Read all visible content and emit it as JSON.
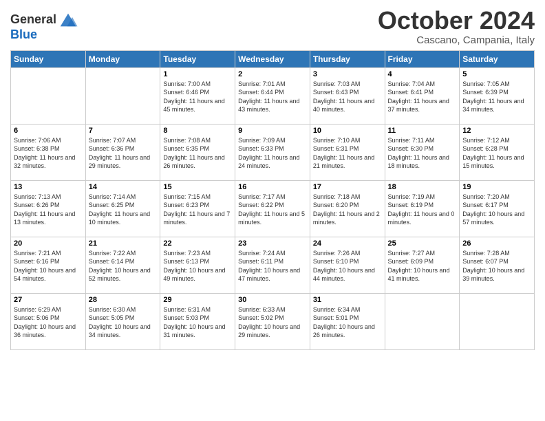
{
  "logo": {
    "line1": "General",
    "line2": "Blue"
  },
  "title": "October 2024",
  "subtitle": "Cascano, Campania, Italy",
  "headers": [
    "Sunday",
    "Monday",
    "Tuesday",
    "Wednesday",
    "Thursday",
    "Friday",
    "Saturday"
  ],
  "weeks": [
    [
      {
        "day": "",
        "info": ""
      },
      {
        "day": "",
        "info": ""
      },
      {
        "day": "1",
        "info": "Sunrise: 7:00 AM\nSunset: 6:46 PM\nDaylight: 11 hours and 45 minutes."
      },
      {
        "day": "2",
        "info": "Sunrise: 7:01 AM\nSunset: 6:44 PM\nDaylight: 11 hours and 43 minutes."
      },
      {
        "day": "3",
        "info": "Sunrise: 7:03 AM\nSunset: 6:43 PM\nDaylight: 11 hours and 40 minutes."
      },
      {
        "day": "4",
        "info": "Sunrise: 7:04 AM\nSunset: 6:41 PM\nDaylight: 11 hours and 37 minutes."
      },
      {
        "day": "5",
        "info": "Sunrise: 7:05 AM\nSunset: 6:39 PM\nDaylight: 11 hours and 34 minutes."
      }
    ],
    [
      {
        "day": "6",
        "info": "Sunrise: 7:06 AM\nSunset: 6:38 PM\nDaylight: 11 hours and 32 minutes."
      },
      {
        "day": "7",
        "info": "Sunrise: 7:07 AM\nSunset: 6:36 PM\nDaylight: 11 hours and 29 minutes."
      },
      {
        "day": "8",
        "info": "Sunrise: 7:08 AM\nSunset: 6:35 PM\nDaylight: 11 hours and 26 minutes."
      },
      {
        "day": "9",
        "info": "Sunrise: 7:09 AM\nSunset: 6:33 PM\nDaylight: 11 hours and 24 minutes."
      },
      {
        "day": "10",
        "info": "Sunrise: 7:10 AM\nSunset: 6:31 PM\nDaylight: 11 hours and 21 minutes."
      },
      {
        "day": "11",
        "info": "Sunrise: 7:11 AM\nSunset: 6:30 PM\nDaylight: 11 hours and 18 minutes."
      },
      {
        "day": "12",
        "info": "Sunrise: 7:12 AM\nSunset: 6:28 PM\nDaylight: 11 hours and 15 minutes."
      }
    ],
    [
      {
        "day": "13",
        "info": "Sunrise: 7:13 AM\nSunset: 6:26 PM\nDaylight: 11 hours and 13 minutes."
      },
      {
        "day": "14",
        "info": "Sunrise: 7:14 AM\nSunset: 6:25 PM\nDaylight: 11 hours and 10 minutes."
      },
      {
        "day": "15",
        "info": "Sunrise: 7:15 AM\nSunset: 6:23 PM\nDaylight: 11 hours and 7 minutes."
      },
      {
        "day": "16",
        "info": "Sunrise: 7:17 AM\nSunset: 6:22 PM\nDaylight: 11 hours and 5 minutes."
      },
      {
        "day": "17",
        "info": "Sunrise: 7:18 AM\nSunset: 6:20 PM\nDaylight: 11 hours and 2 minutes."
      },
      {
        "day": "18",
        "info": "Sunrise: 7:19 AM\nSunset: 6:19 PM\nDaylight: 11 hours and 0 minutes."
      },
      {
        "day": "19",
        "info": "Sunrise: 7:20 AM\nSunset: 6:17 PM\nDaylight: 10 hours and 57 minutes."
      }
    ],
    [
      {
        "day": "20",
        "info": "Sunrise: 7:21 AM\nSunset: 6:16 PM\nDaylight: 10 hours and 54 minutes."
      },
      {
        "day": "21",
        "info": "Sunrise: 7:22 AM\nSunset: 6:14 PM\nDaylight: 10 hours and 52 minutes."
      },
      {
        "day": "22",
        "info": "Sunrise: 7:23 AM\nSunset: 6:13 PM\nDaylight: 10 hours and 49 minutes."
      },
      {
        "day": "23",
        "info": "Sunrise: 7:24 AM\nSunset: 6:11 PM\nDaylight: 10 hours and 47 minutes."
      },
      {
        "day": "24",
        "info": "Sunrise: 7:26 AM\nSunset: 6:10 PM\nDaylight: 10 hours and 44 minutes."
      },
      {
        "day": "25",
        "info": "Sunrise: 7:27 AM\nSunset: 6:09 PM\nDaylight: 10 hours and 41 minutes."
      },
      {
        "day": "26",
        "info": "Sunrise: 7:28 AM\nSunset: 6:07 PM\nDaylight: 10 hours and 39 minutes."
      }
    ],
    [
      {
        "day": "27",
        "info": "Sunrise: 6:29 AM\nSunset: 5:06 PM\nDaylight: 10 hours and 36 minutes."
      },
      {
        "day": "28",
        "info": "Sunrise: 6:30 AM\nSunset: 5:05 PM\nDaylight: 10 hours and 34 minutes."
      },
      {
        "day": "29",
        "info": "Sunrise: 6:31 AM\nSunset: 5:03 PM\nDaylight: 10 hours and 31 minutes."
      },
      {
        "day": "30",
        "info": "Sunrise: 6:33 AM\nSunset: 5:02 PM\nDaylight: 10 hours and 29 minutes."
      },
      {
        "day": "31",
        "info": "Sunrise: 6:34 AM\nSunset: 5:01 PM\nDaylight: 10 hours and 26 minutes."
      },
      {
        "day": "",
        "info": ""
      },
      {
        "day": "",
        "info": ""
      }
    ]
  ]
}
